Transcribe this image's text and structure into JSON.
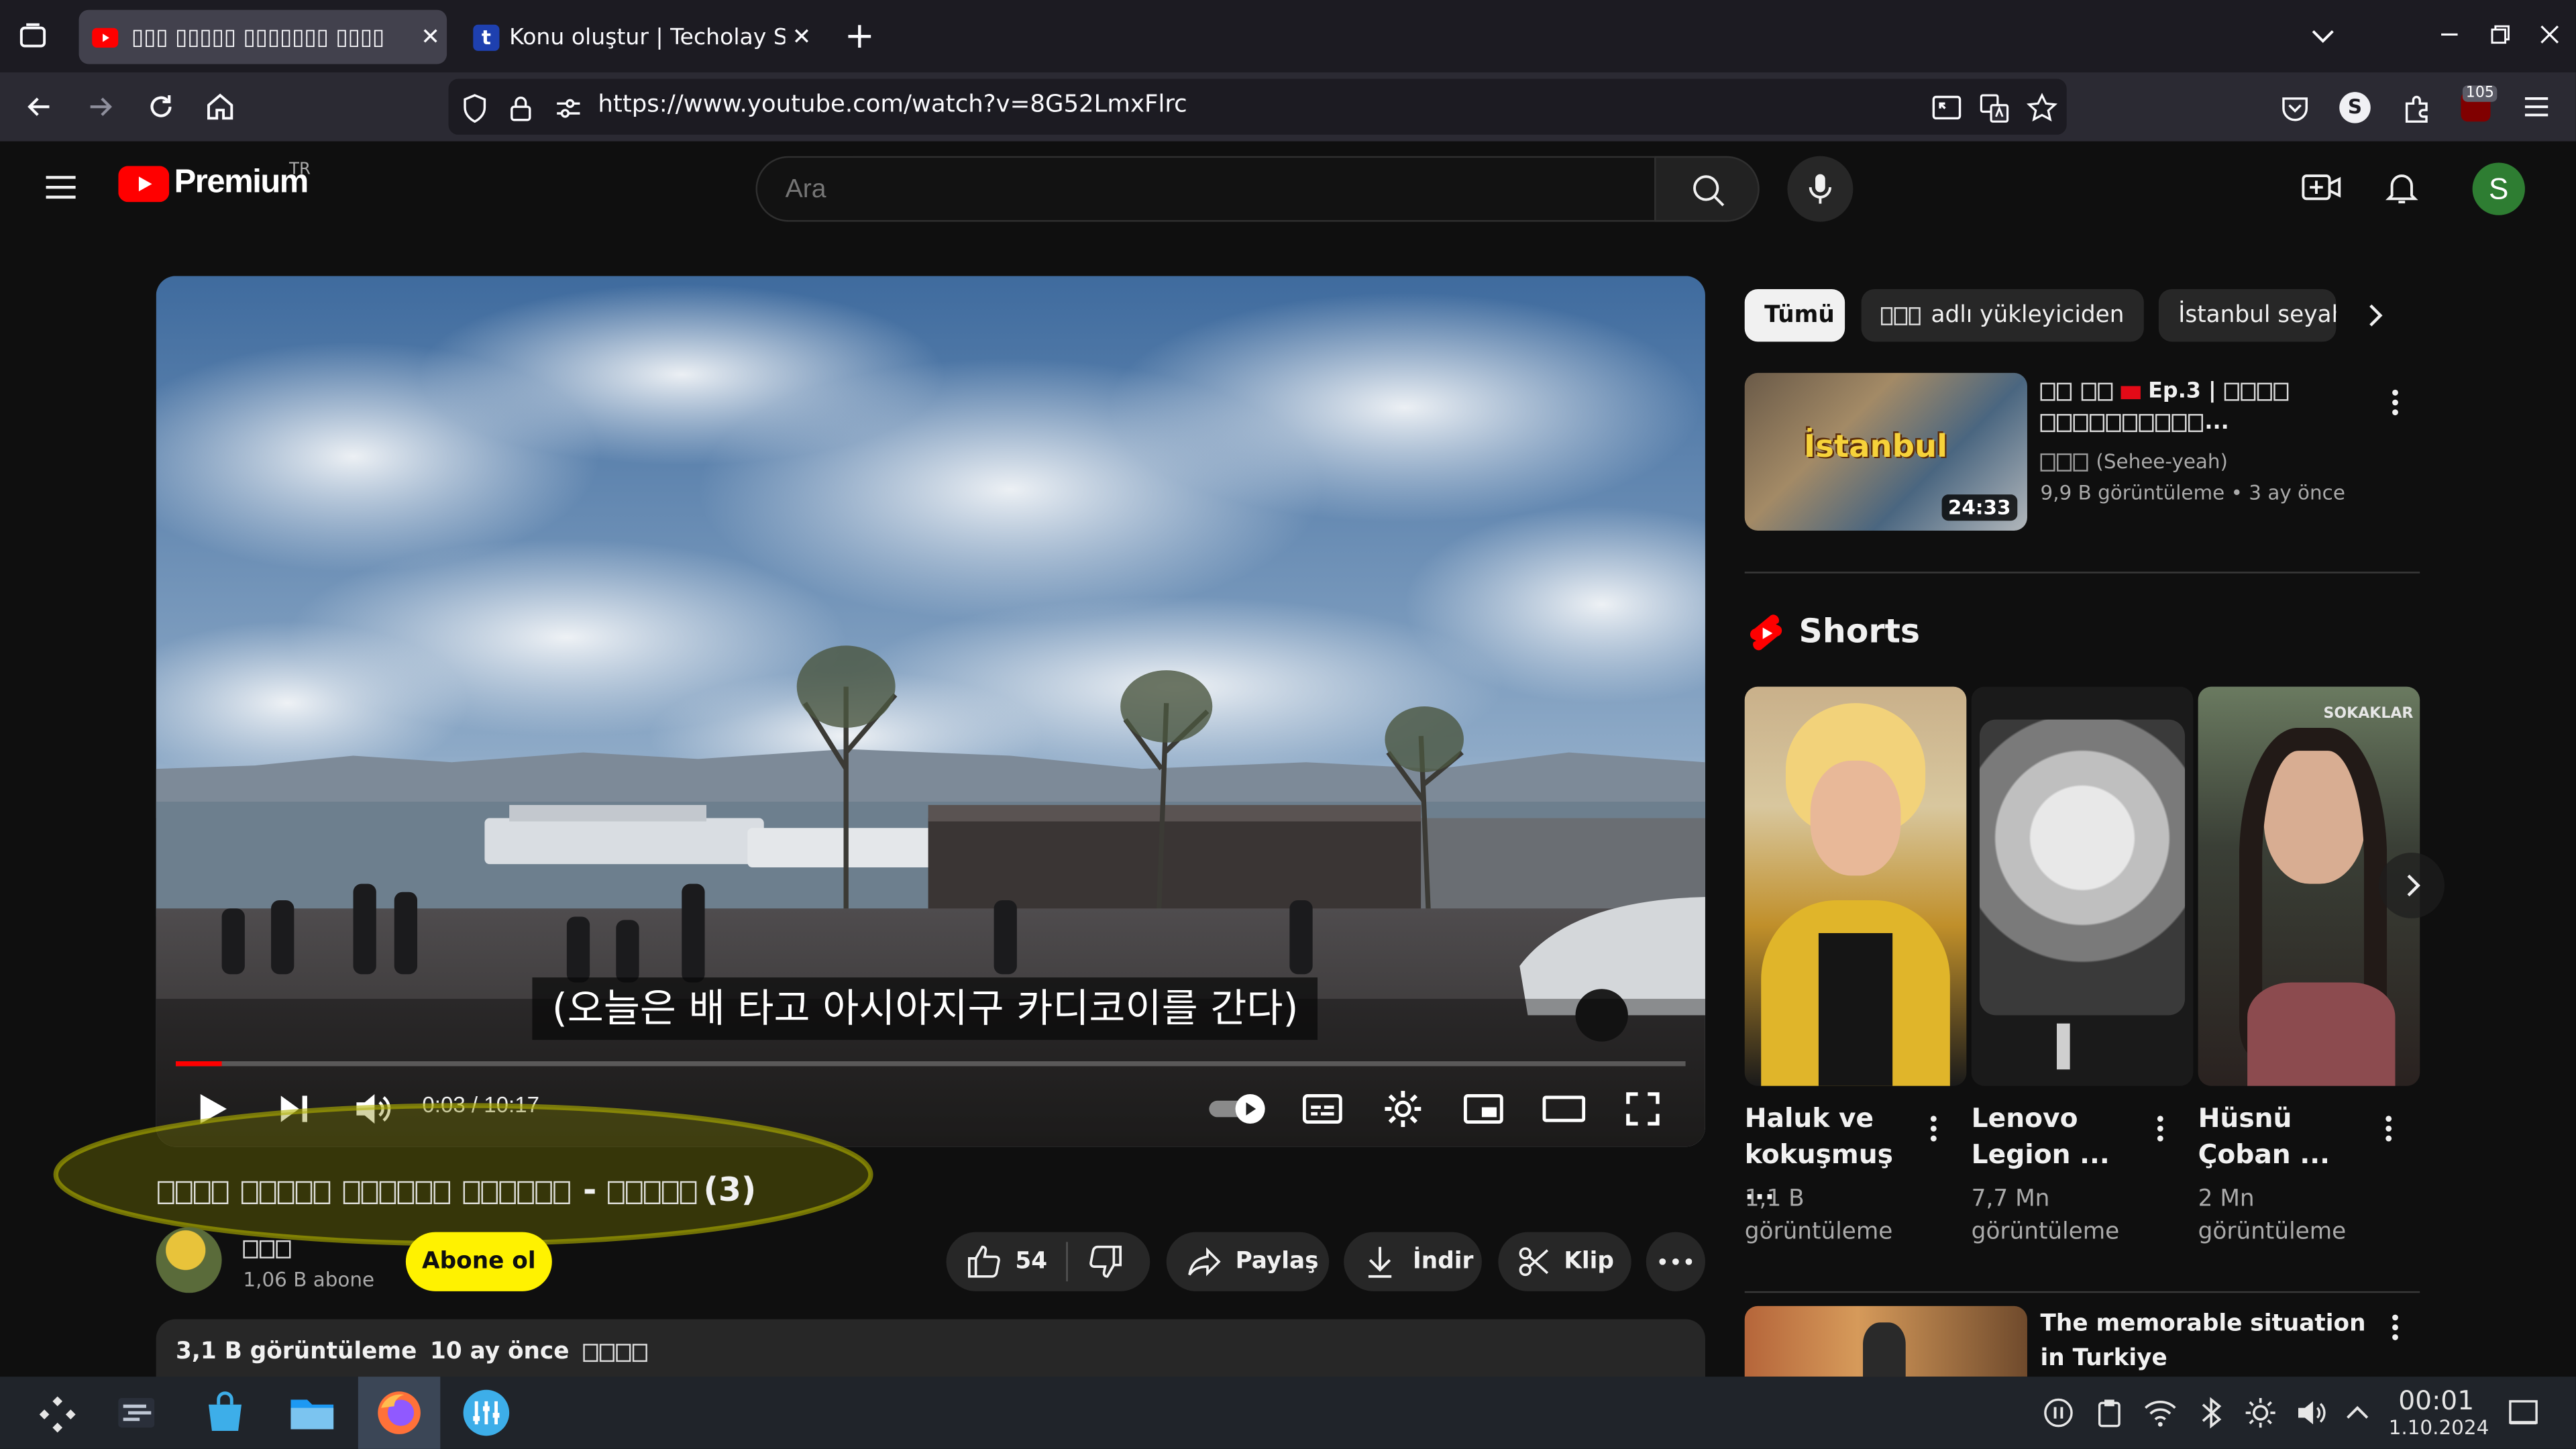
{
  "browser": {
    "tabs": [
      {
        "title": "▯▯▯ ▯▯▯▯▯ ▯▯▯▯▯▯▯ ▯▯▯▯",
        "active": true
      },
      {
        "title": "Konu oluştur | Techolay Sosyal",
        "active": false
      }
    ],
    "url": "https://www.youtube.com/watch?v=8G52LmxFlrc",
    "extension_badge": "105"
  },
  "yt": {
    "logo_text": "Premium",
    "logo_region": "TR",
    "search_placeholder": "Ara",
    "avatar_letter": "S",
    "colors": {
      "brand_red": "#ff0000",
      "avatar_bg": "#2e7d32",
      "subscribe_bg": "#fff200"
    }
  },
  "player": {
    "subtitle": "(오늘은 배 타고 아시아지구 카디코이를 간다)",
    "time": "0:03 / 10:17",
    "progress_fraction": 0.005
  },
  "video": {
    "title_suffix": "(3)",
    "channel_subs": "1,06 B abone",
    "subscribe_label": "Abone ol",
    "likes": "54",
    "share_label": "Paylaş",
    "download_label": "İndir",
    "clip_label": "Klip",
    "views": "3,1 B görüntüleme",
    "date": "10 ay önce"
  },
  "sidebar": {
    "chips": [
      "Tümü",
      "adlı yükleyiciden",
      "İstanbul seyahati"
    ],
    "rec1": {
      "title_part": "Ep.3 |",
      "channel": "(Sehee-yeah)",
      "views": "9,9 B görüntüleme",
      "age": "3 ay önce",
      "duration": "24:33",
      "thumb_text": "İstanbul"
    },
    "shorts_heading": "Shorts",
    "shorts": [
      {
        "title": "Haluk ve kokuşmuş ...",
        "views": "1,1 B görüntüleme"
      },
      {
        "title": "Lenovo Legion ...",
        "views": "7,7 Mn görüntüleme"
      },
      {
        "title": "Hüsnü Çoban ...",
        "views": "2 Mn görüntüleme"
      }
    ],
    "short3_badge": "SOKAKLAR",
    "rec2_title": "The memorable situation in Turkiye"
  },
  "taskbar": {
    "time": "00:01",
    "date": "1.10.2024"
  }
}
